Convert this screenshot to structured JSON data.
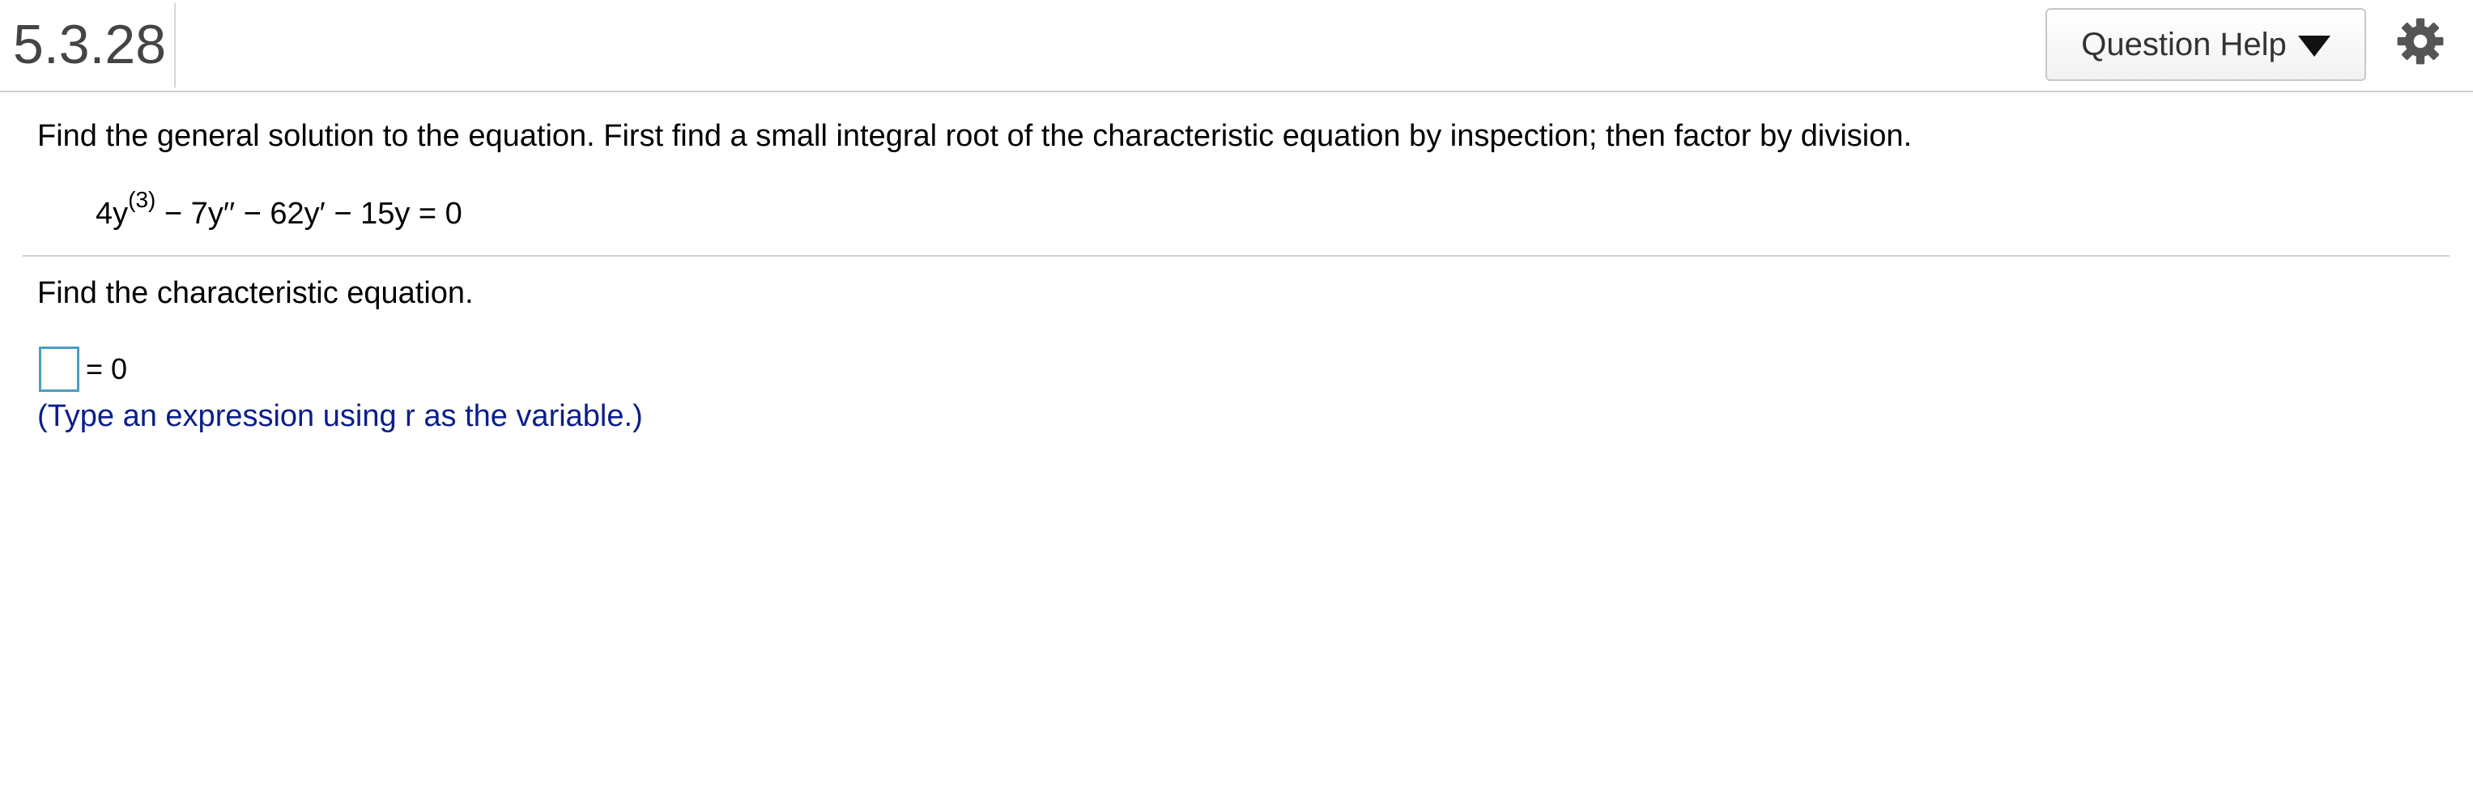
{
  "header": {
    "question_number": "5.3.28",
    "help_button_label": "Question Help"
  },
  "icons": {
    "help_caret": "caret-down-icon",
    "settings": "gear-icon"
  },
  "problem": {
    "instructions": "Find the general solution to the equation. First find a small integral root of the characteristic equation by inspection; then factor by division.",
    "equation": {
      "lead": "4y",
      "superscript": "(3)",
      "rest": " − 7y′′ − 62y′ − 15y = 0"
    }
  },
  "part": {
    "prompt": "Find the characteristic equation.",
    "answer_value": "",
    "answer_rhs": "= 0",
    "hint": "(Type an expression using r as the variable.)"
  },
  "colors": {
    "input_border": "#4a9fc0",
    "hint_text": "#0b1e8a",
    "divider": "#d0d0d0"
  }
}
